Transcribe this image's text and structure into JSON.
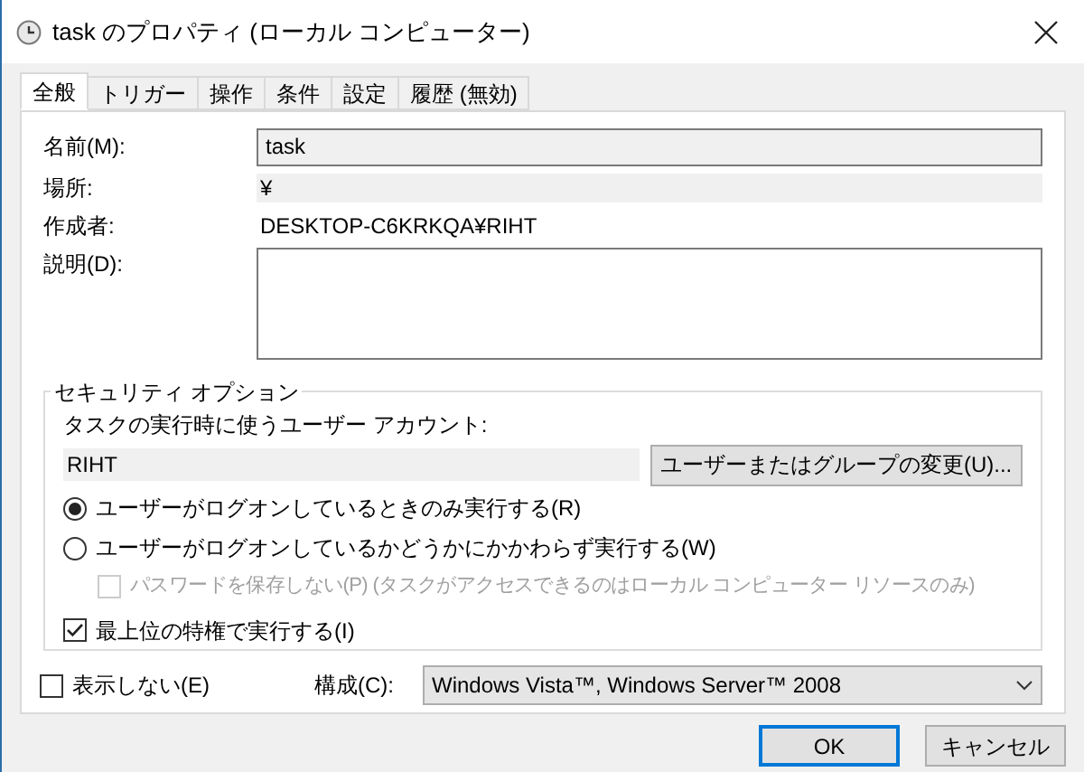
{
  "window": {
    "title": "task のプロパティ (ローカル コンピューター)"
  },
  "tabs": [
    {
      "label": "全般",
      "selected": true
    },
    {
      "label": "トリガー",
      "selected": false
    },
    {
      "label": "操作",
      "selected": false
    },
    {
      "label": "条件",
      "selected": false
    },
    {
      "label": "設定",
      "selected": false
    },
    {
      "label": "履歴 (無効)",
      "selected": false
    }
  ],
  "general": {
    "name": {
      "label": "名前(M):",
      "value": "task"
    },
    "location": {
      "label": "場所:",
      "value": "¥"
    },
    "author": {
      "label": "作成者:",
      "value": "DESKTOP-C6KRKQA¥RIHT"
    },
    "description": {
      "label": "説明(D):"
    }
  },
  "security": {
    "title": "セキュリティ オプション",
    "account_label": "タスクの実行時に使うユーザー アカウント:",
    "account": "RIHT",
    "change_button": "ユーザーまたはグループの変更(U)...",
    "radios": [
      {
        "label": "ユーザーがログオンしているときのみ実行する(R)",
        "selected": true
      },
      {
        "label": "ユーザーがログオンしているかどうかにかかわらず実行する(W)",
        "selected": false
      }
    ],
    "no_password": {
      "label": "パスワードを保存しない(P) (タスクがアクセスできるのはローカル コンピューター リソースのみ)",
      "checked": false,
      "disabled": true
    },
    "highest": {
      "label": "最上位の特権で実行する(I)",
      "checked": true,
      "disabled": false
    }
  },
  "hidden": {
    "label": "表示しない(E)",
    "checked": false,
    "disabled": false
  },
  "configure": {
    "label": "構成(C):",
    "value": "Windows Vista™, Windows Server™ 2008"
  },
  "buttons": [
    {
      "label": "OK",
      "default": true
    },
    {
      "label": "キャンセル",
      "default": false
    }
  ]
}
